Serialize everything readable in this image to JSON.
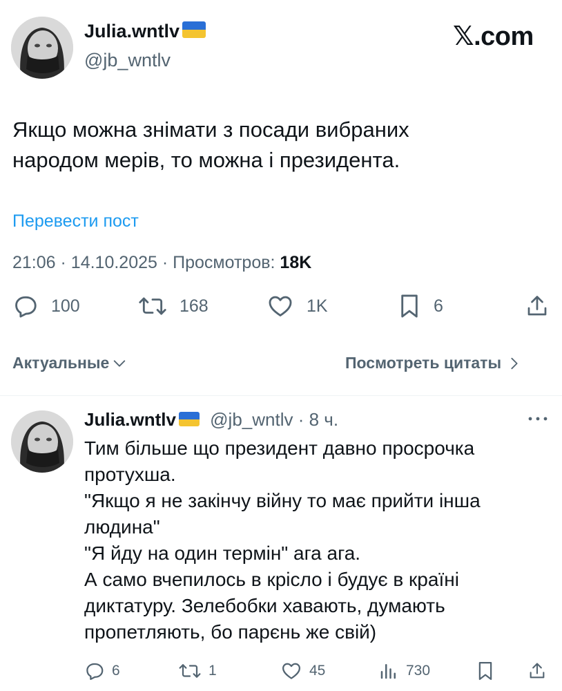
{
  "post": {
    "author_name": "Julia.wntlv",
    "author_handle": "@jb_wntlv",
    "site_label": "𝕏.com",
    "text": "Якщо можна знімати з посади вибраних\nнародом мерів, то можна і президента.",
    "translate_label": "Перевести пост",
    "time": "21:06",
    "date": "14.10.2025",
    "views_label": "Просмотров:",
    "views_count": "18K",
    "actions": {
      "replies": "100",
      "reposts": "168",
      "likes": "1K",
      "bookmarks": "6"
    }
  },
  "sort_bar": {
    "sort_label": "Актуальные",
    "quotes_label": "Посмотреть цитаты"
  },
  "reply": {
    "author_name": "Julia.wntlv",
    "author_handle": "@jb_wntlv",
    "time_ago": "8 ч.",
    "text": "Тим більше що президент давно просрочка\nпротухша.\n\"Якщо я не закінчу війну то має прийти інша\nлюдина\"\n\"Я йду на один термін\" ага ага.\nА само вчепилось в крісло і будує в країні\nдиктатуру. Зелебобки хавають, думають\nпропетляють, бо парєнь же свій)",
    "actions": {
      "replies": "6",
      "reposts": "1",
      "likes": "45",
      "views": "730"
    }
  },
  "colors": {
    "link_blue": "#1d9bf0",
    "secondary_text": "#536471",
    "primary_text": "#0f1419",
    "flag_blue": "#2a6fd6",
    "flag_yellow": "#f4c430"
  },
  "icons": [
    "reply-icon",
    "repost-icon",
    "like-icon",
    "bookmark-icon",
    "share-icon",
    "views-icon",
    "more-icon",
    "chevron-down-icon",
    "chevron-right-icon",
    "ukraine-flag-icon",
    "x-logo"
  ]
}
